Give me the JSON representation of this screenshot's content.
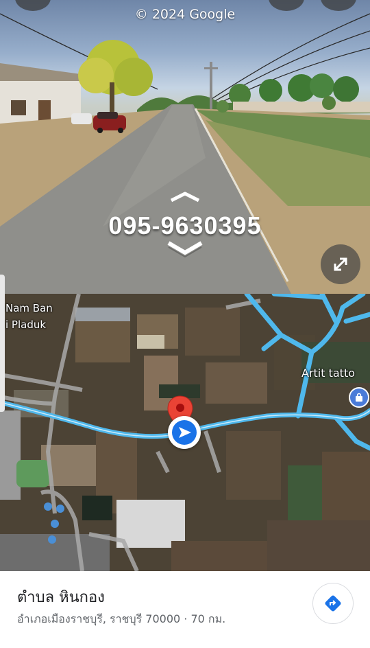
{
  "street_view": {
    "copyright": "© 2024 Google",
    "phone_overlay": "095-9630395",
    "icons": {
      "nav_up": "chevron-up-icon",
      "nav_down": "chevron-down-icon",
      "expand": "expand-icon"
    }
  },
  "map": {
    "labels": {
      "place_line1": "Nam Ban",
      "place_line2": "i Pladuk",
      "poi": "Artit tatto"
    },
    "colors": {
      "road": "#4fb8ec",
      "pin": "#ea4335",
      "location": "#1a73e8"
    }
  },
  "place": {
    "title": "ตำบล หินกอง",
    "address": "อำเภอเมืองราชบุรี, ราชบุรี 70000 · 70 กม."
  }
}
